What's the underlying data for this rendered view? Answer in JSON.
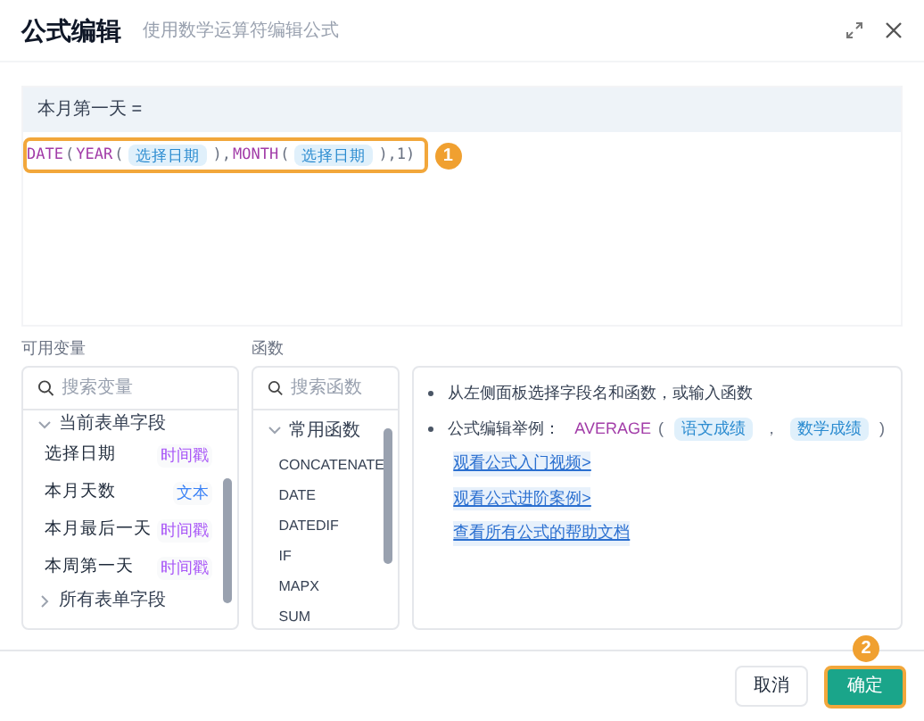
{
  "header": {
    "title": "公式编辑",
    "subtitle": "使用数学运算符编辑公式"
  },
  "editor": {
    "target": "本月第一天 =",
    "tokens": [
      {
        "kind": "fn",
        "text": "DATE"
      },
      {
        "kind": "punct",
        "text": "("
      },
      {
        "kind": "fn",
        "text": "YEAR"
      },
      {
        "kind": "punct",
        "text": "("
      },
      {
        "kind": "field",
        "text": "选择日期"
      },
      {
        "kind": "punct",
        "text": "),"
      },
      {
        "kind": "fn",
        "text": "MONTH"
      },
      {
        "kind": "punct",
        "text": "("
      },
      {
        "kind": "field",
        "text": "选择日期"
      },
      {
        "kind": "punct",
        "text": "),1)"
      }
    ],
    "marker": "1"
  },
  "variables": {
    "label": "可用变量",
    "placeholder": "搜索变量",
    "groups": [
      {
        "name": "当前表单字段",
        "expanded": true,
        "items": [
          {
            "name": "选择日期",
            "tag": "时间戳",
            "color": "#a855f7"
          },
          {
            "name": "本月天数",
            "tag": "文本",
            "color": "#3b82f6"
          },
          {
            "name": "本月最后一天",
            "tag": "时间戳",
            "color": "#a855f7"
          },
          {
            "name": "本周第一天",
            "tag": "时间戳",
            "color": "#a855f7"
          }
        ]
      },
      {
        "name": "所有表单字段",
        "expanded": false
      }
    ]
  },
  "functions": {
    "label": "函数",
    "placeholder": "搜索函数",
    "groups": [
      {
        "name": "常用函数",
        "expanded": true,
        "items": [
          "CONCATENATE",
          "DATE",
          "DATEDIF",
          "IF",
          "MAPX",
          "SUM"
        ]
      }
    ]
  },
  "help": {
    "tips": [
      "从左侧面板选择字段名和函数，或输入函数"
    ],
    "example_label": "公式编辑举例：",
    "example": [
      {
        "kind": "fn",
        "text": "AVERAGE"
      },
      {
        "kind": "punct",
        "text": "("
      },
      {
        "kind": "field",
        "text": "语文成绩"
      },
      {
        "kind": "punct",
        "text": "，"
      },
      {
        "kind": "field",
        "text": "数学成绩"
      },
      {
        "kind": "punct",
        "text": ")"
      }
    ],
    "links": [
      "观看公式入门视频>",
      "观看公式进阶案例>",
      "查看所有公式的帮助文档"
    ]
  },
  "footer": {
    "cancel": "取消",
    "confirm": "确定",
    "marker": "2"
  }
}
